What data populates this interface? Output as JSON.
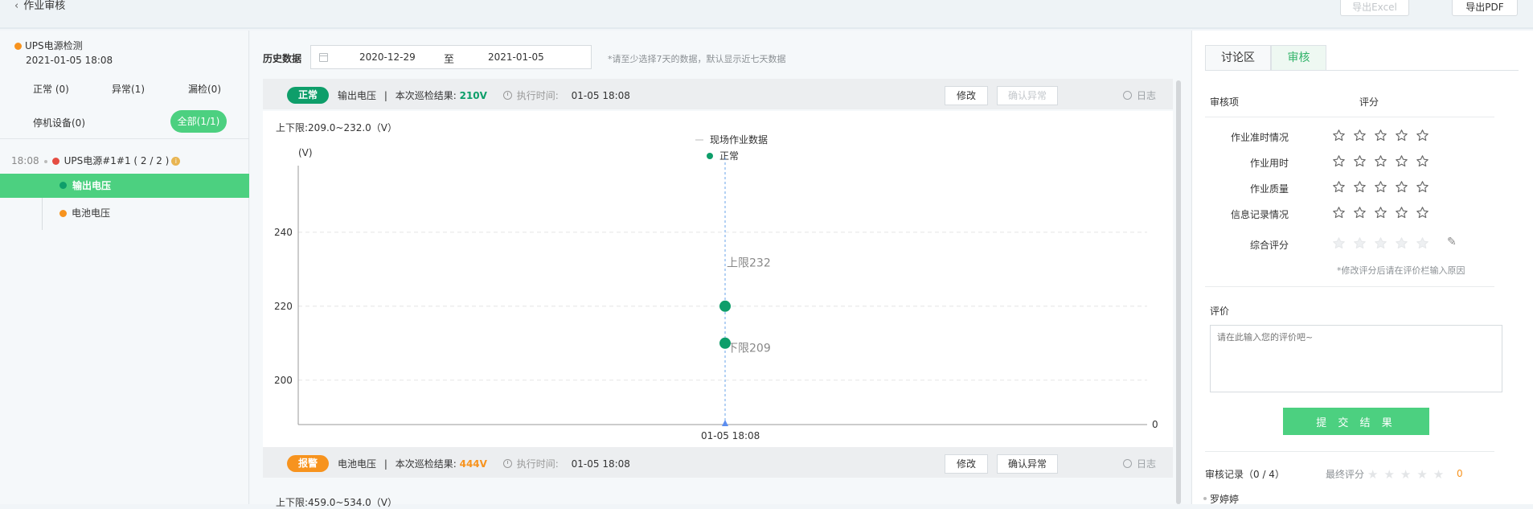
{
  "header": {
    "back_label": "作业审核",
    "export_excel": "导出Excel",
    "export_pdf": "导出PDF"
  },
  "left": {
    "project_title": "UPS电源检测",
    "project_time": "2021-01-05 18:08",
    "filters": {
      "normal": "正常 (0)",
      "abnormal": "异常(1)",
      "missed": "漏检(0)",
      "stopped": "停机设备(0)",
      "all": "全部(1/1)"
    },
    "device": {
      "time": "18:08",
      "name": "UPS电源#1#1 ( 2 / 2 )",
      "info": "i"
    },
    "items": [
      {
        "label": "输出电压"
      },
      {
        "label": "电池电压"
      }
    ]
  },
  "main": {
    "history_label": "历史数据",
    "date_from": "2020-12-29",
    "date_sep": "至",
    "date_to": "2021-01-05",
    "hint": "*请至少选择7天的数据，默认显示近七天数据",
    "items": [
      {
        "badge": "正常",
        "name": "输出电压",
        "sep": "|",
        "result_label": "本次巡检结果:",
        "result_value": "210V",
        "exec_label": "执行时间:",
        "exec_time": "01-05 18:08",
        "modify": "修改",
        "confirm": "确认异常",
        "log": "日志",
        "limits": "上下限:209.0~232.0（V）"
      },
      {
        "badge": "报警",
        "name": "电池电压",
        "sep": "|",
        "result_label": "本次巡检结果:",
        "result_value": "444V",
        "exec_label": "执行时间:",
        "exec_time": "01-05 18:08",
        "modify": "修改",
        "confirm": "确认异常",
        "log": "日志",
        "limits": "上下限:459.0~534.0（V）"
      }
    ]
  },
  "chart_data": {
    "type": "scatter",
    "legend": {
      "line": "现场作业数据",
      "point": "正常"
    },
    "ylabel": "(V)",
    "ylim": [
      188,
      258
    ],
    "yticks": [
      200,
      220,
      240
    ],
    "x": [
      "01-05 18:08"
    ],
    "x_end_label": "0",
    "series": [
      {
        "name": "正常",
        "values": [
          220,
          210
        ]
      }
    ],
    "annotations": [
      {
        "label": "上限232",
        "value": 232
      },
      {
        "label": "下限209",
        "value": 209
      }
    ],
    "colors": {
      "point": "#0e9e6a",
      "vline": "#6aa3e8",
      "grid": "#e6e6e6"
    }
  },
  "review": {
    "tabs": [
      "讨论区",
      "审核"
    ],
    "col_item": "审核项",
    "col_score": "评分",
    "criteria": [
      {
        "label": "作业准时情况"
      },
      {
        "label": "作业用时"
      },
      {
        "label": "作业质量"
      },
      {
        "label": "信息记录情况"
      }
    ],
    "overall_label": "综合评分",
    "note": "*修改评分后请在评价栏输入原因",
    "eval_label": "评价",
    "eval_placeholder": "请在此输入您的评价吧~",
    "submit": "提 交 结 果",
    "record_label": "审核记录（0 / 4）",
    "final_label": "最终评分",
    "final_score": "0",
    "person": "罗婷婷"
  },
  "colors": {
    "accent": "#4cd080",
    "ok": "#0e9e6a",
    "warn": "#f7931e"
  }
}
